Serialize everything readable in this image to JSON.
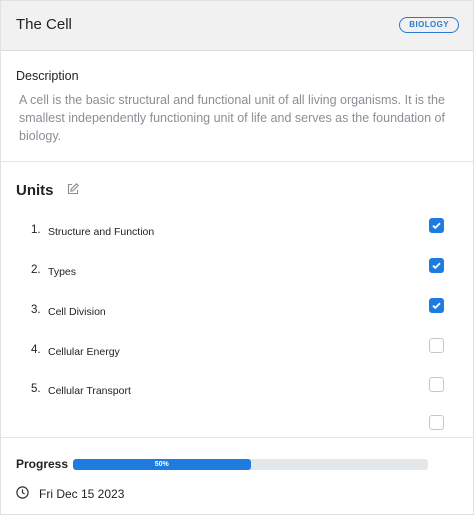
{
  "header": {
    "title": "The Cell",
    "badge": "BIOLOGY"
  },
  "description": {
    "heading": "Description",
    "text": "A cell is the basic structural and functional unit of all living organisms. It is the smallest independently functioning unit of life and serves as the foundation of biology."
  },
  "units": {
    "heading": "Units",
    "items": [
      {
        "num": "1.",
        "label": "Structure and Function",
        "checked": true
      },
      {
        "num": "2.",
        "label": "Types",
        "checked": true
      },
      {
        "num": "3.",
        "label": "Cell Division",
        "checked": true
      },
      {
        "num": "4.",
        "label": "Cellular Energy",
        "checked": false
      },
      {
        "num": "5.",
        "label": "Cellular Transport",
        "checked": false
      },
      {
        "num": "",
        "label": "",
        "checked": false
      }
    ]
  },
  "progress": {
    "label": "Progress",
    "value": 50,
    "text": "50%"
  },
  "date": {
    "text": "Fri Dec 15 2023"
  },
  "colors": {
    "accent": "#1e7be0",
    "badge": "#2a7ad4"
  },
  "icons": {
    "edit": "pencil-edit-icon",
    "clock": "clock-icon",
    "check": "checkmark-icon"
  }
}
